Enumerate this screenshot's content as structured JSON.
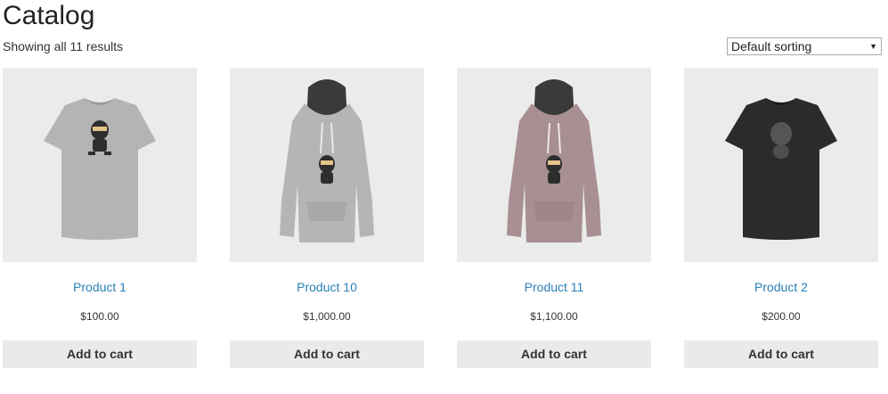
{
  "page": {
    "title": "Catalog",
    "result_count": "Showing all 11 results"
  },
  "sorting": {
    "selected": "Default sorting"
  },
  "colors": {
    "link": "#2a7fb8",
    "image_bg": "#ebebeb",
    "button_bg": "#ebe9eb"
  },
  "products": [
    {
      "name": "Product 1",
      "price": "$100.00",
      "button": "Add to cart",
      "image": "grey-tshirt-ninja-icon"
    },
    {
      "name": "Product 10",
      "price": "$1,000.00",
      "button": "Add to cart",
      "image": "grey-hoodie-ninja-icon"
    },
    {
      "name": "Product 11",
      "price": "$1,100.00",
      "button": "Add to cart",
      "image": "pink-hoodie-ninja-icon"
    },
    {
      "name": "Product 2",
      "price": "$200.00",
      "button": "Add to cart",
      "image": "black-tshirt-icon"
    }
  ]
}
